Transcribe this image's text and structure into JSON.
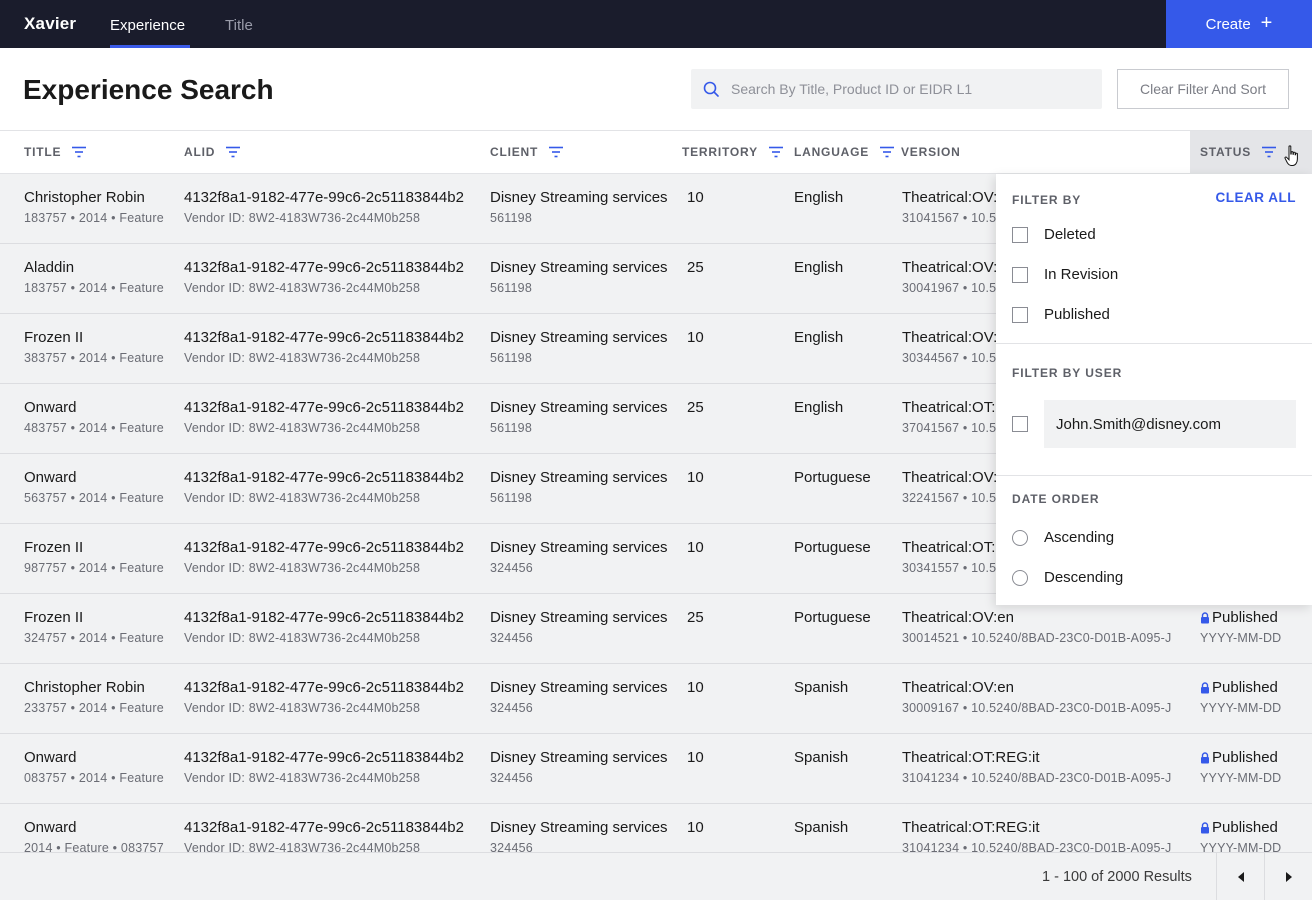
{
  "nav": {
    "brand": "Xavier",
    "tabs": [
      {
        "label": "Experience",
        "active": true
      },
      {
        "label": "Title",
        "active": false
      }
    ],
    "create_label": "Create",
    "create_icon": "+"
  },
  "header": {
    "title": "Experience Search",
    "search_placeholder": "Search By Title, Product ID or EIDR L1",
    "clear_label": "Clear Filter And Sort"
  },
  "columns": {
    "title": "TITLE",
    "alid": "ALID",
    "client": "CLIENT",
    "territory": "TERRITORY",
    "language": "LANGUAGE",
    "version": "VERSION",
    "status": "STATUS"
  },
  "rows": [
    {
      "title": "Christopher Robin",
      "title_meta": "183757 • 2014 • Feature",
      "alid": "4132f8a1-9182-477e-99c6-2c51183844b2",
      "vendor": "Vendor ID: 8W2-4183W736-2c44M0b258",
      "client": "Disney Streaming services",
      "client_id": "561198",
      "territory": "10",
      "language": "English",
      "version": "Theatrical:OV:",
      "version_meta": "31041567 • 10.5",
      "status": "",
      "status_date": ""
    },
    {
      "title": "Aladdin",
      "title_meta": "183757 • 2014 • Feature",
      "alid": "4132f8a1-9182-477e-99c6-2c51183844b2",
      "vendor": "Vendor ID: 8W2-4183W736-2c44M0b258",
      "client": "Disney Streaming services",
      "client_id": "561198",
      "territory": "25",
      "language": "English",
      "version": "Theatrical:OV:",
      "version_meta": "30041967 • 10.5",
      "status": "",
      "status_date": ""
    },
    {
      "title": "Frozen II",
      "title_meta": "383757 • 2014 • Feature",
      "alid": "4132f8a1-9182-477e-99c6-2c51183844b2",
      "vendor": "Vendor ID: 8W2-4183W736-2c44M0b258",
      "client": "Disney Streaming services",
      "client_id": "561198",
      "territory": "10",
      "language": "English",
      "version": "Theatrical:OV:",
      "version_meta": "30344567 • 10.5",
      "status": "",
      "status_date": ""
    },
    {
      "title": "Onward",
      "title_meta": "483757 • 2014 • Feature",
      "alid": "4132f8a1-9182-477e-99c6-2c51183844b2",
      "vendor": "Vendor ID: 8W2-4183W736-2c44M0b258",
      "client": "Disney Streaming services",
      "client_id": "561198",
      "territory": "25",
      "language": "English",
      "version": "Theatrical:OT:",
      "version_meta": "37041567 • 10.5",
      "status": "",
      "status_date": ""
    },
    {
      "title": "Onward",
      "title_meta": "563757 • 2014 • Feature",
      "alid": "4132f8a1-9182-477e-99c6-2c51183844b2",
      "vendor": "Vendor ID: 8W2-4183W736-2c44M0b258",
      "client": "Disney Streaming services",
      "client_id": "561198",
      "territory": "10",
      "language": "Portuguese",
      "version": "Theatrical:OV:",
      "version_meta": "32241567 • 10.5",
      "status": "",
      "status_date": ""
    },
    {
      "title": "Frozen II",
      "title_meta": "987757 • 2014 • Feature",
      "alid": "4132f8a1-9182-477e-99c6-2c51183844b2",
      "vendor": "Vendor ID: 8W2-4183W736-2c44M0b258",
      "client": "Disney Streaming services",
      "client_id": "324456",
      "territory": "10",
      "language": "Portuguese",
      "version": "Theatrical:OT:",
      "version_meta": "30341557 • 10.5",
      "status": "",
      "status_date": ""
    },
    {
      "title": "Frozen II",
      "title_meta": "324757 • 2014 • Feature",
      "alid": "4132f8a1-9182-477e-99c6-2c51183844b2",
      "vendor": "Vendor ID: 8W2-4183W736-2c44M0b258",
      "client": "Disney Streaming services",
      "client_id": "324456",
      "territory": "25",
      "language": "Portuguese",
      "version": "Theatrical:OV:en",
      "version_meta": "30014521 • 10.5240/8BAD-23C0-D01B-A095-J",
      "status": "Published",
      "status_date": "YYYY-MM-DD"
    },
    {
      "title": "Christopher Robin",
      "title_meta": "233757 • 2014 • Feature",
      "alid": "4132f8a1-9182-477e-99c6-2c51183844b2",
      "vendor": "Vendor ID: 8W2-4183W736-2c44M0b258",
      "client": "Disney Streaming services",
      "client_id": "324456",
      "territory": "10",
      "language": "Spanish",
      "version": "Theatrical:OV:en",
      "version_meta": "30009167 • 10.5240/8BAD-23C0-D01B-A095-J",
      "status": "Published",
      "status_date": "YYYY-MM-DD"
    },
    {
      "title": "Onward",
      "title_meta": "083757 • 2014 • Feature",
      "alid": "4132f8a1-9182-477e-99c6-2c51183844b2",
      "vendor": "Vendor ID: 8W2-4183W736-2c44M0b258",
      "client": "Disney Streaming services",
      "client_id": "324456",
      "territory": "10",
      "language": "Spanish",
      "version": "Theatrical:OT:REG:it",
      "version_meta": "31041234 • 10.5240/8BAD-23C0-D01B-A095-J",
      "status": "Published",
      "status_date": "YYYY-MM-DD"
    },
    {
      "title": "Onward",
      "title_meta": "2014 • Feature • 083757",
      "alid": "4132f8a1-9182-477e-99c6-2c51183844b2",
      "vendor": "Vendor ID: 8W2-4183W736-2c44M0b258",
      "client": "Disney Streaming services",
      "client_id": "324456",
      "territory": "10",
      "language": "Spanish",
      "version": "Theatrical:OT:REG:it",
      "version_meta": "31041234 • 10.5240/8BAD-23C0-D01B-A095-J",
      "status": "Published",
      "status_date": "YYYY-MM-DD"
    }
  ],
  "footer": {
    "results": "1 - 100 of 2000 Results",
    "prev_icon": "◀",
    "next_icon": "▶"
  },
  "filter_panel": {
    "filter_by_title": "FILTER BY",
    "clear_all": "CLEAR ALL",
    "status_options": [
      "Deleted",
      "In Revision",
      "Published"
    ],
    "filter_by_user_title": "FILTER BY USER",
    "user": "John.Smith@disney.com",
    "date_order_title": "DATE ORDER",
    "date_options": [
      "Ascending",
      "Descending"
    ]
  },
  "colors": {
    "nav_bg": "#1a1c2c",
    "accent": "#3559e9",
    "row_bg": "#f1f2f3"
  },
  "icons": {
    "search": "search-icon",
    "filter": "filter-icon",
    "lock": "lock-icon",
    "cursor": "hand-cursor-icon"
  }
}
